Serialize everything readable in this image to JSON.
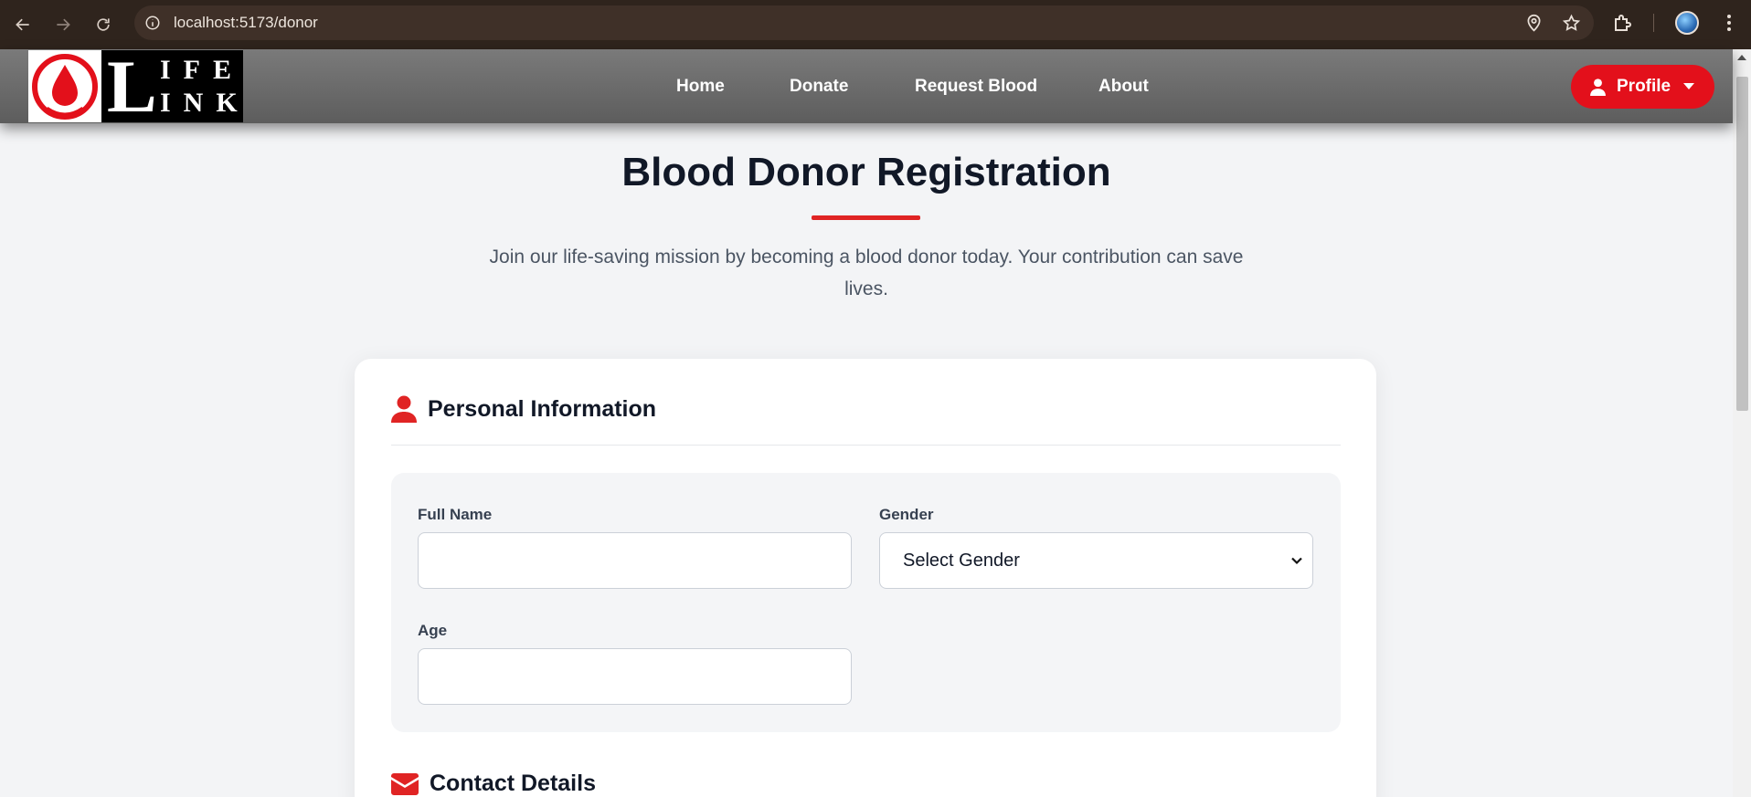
{
  "browser": {
    "url": "localhost:5173/donor"
  },
  "brand": {
    "logo_letter": "L",
    "logo_top": "IFE",
    "logo_bottom": "INK",
    "accent_color": "#e02424"
  },
  "nav": {
    "items": [
      {
        "label": "Home"
      },
      {
        "label": "Donate"
      },
      {
        "label": "Request Blood"
      },
      {
        "label": "About"
      }
    ],
    "profile_label": "Profile"
  },
  "page": {
    "title": "Blood Donor Registration",
    "subtitle": "Join our life-saving mission by becoming a blood donor today. Your contribution can save lives."
  },
  "personal": {
    "heading": "Personal Information",
    "full_name_label": "Full Name",
    "full_name_value": "",
    "gender_label": "Gender",
    "gender_value": "Select Gender",
    "age_label": "Age",
    "age_value": ""
  },
  "contact": {
    "heading": "Contact Details"
  }
}
